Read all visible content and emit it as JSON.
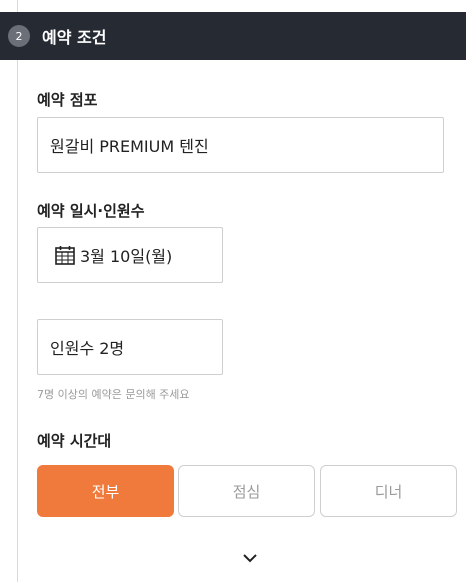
{
  "section": {
    "step_number": "2",
    "title": "예약 조건"
  },
  "store": {
    "label": "예약 점포",
    "value": "원갈비 PREMIUM 텐진"
  },
  "datetime": {
    "label": "예약 일시·인원수",
    "date_value": "3월 10일(월)",
    "people_value": "인원수 2명",
    "note": "7명 이상의 예약은 문의해 주세요"
  },
  "time_slot": {
    "label": "예약 시간대",
    "options": [
      "전부",
      "점심",
      "디너"
    ],
    "selected": "전부"
  },
  "colors": {
    "header_bg": "#262a33",
    "accent": "#f07a3c"
  },
  "icons": {
    "calendar": "calendar-icon",
    "expand": "chevron-down-icon"
  }
}
